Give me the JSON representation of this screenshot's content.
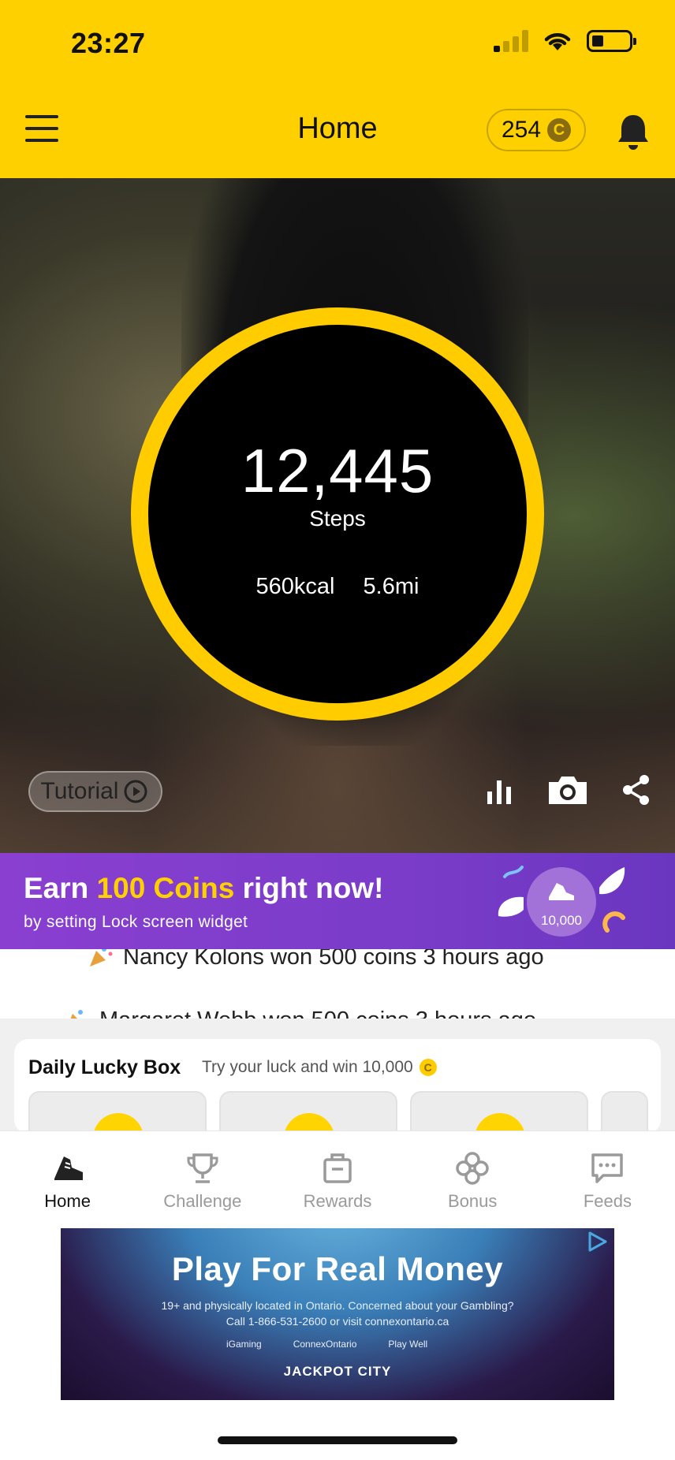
{
  "status_bar": {
    "time": "23:27"
  },
  "header": {
    "title": "Home",
    "coins": "254",
    "coin_symbol": "C"
  },
  "hero": {
    "steps": "12,445",
    "steps_label": "Steps",
    "kcal": "560kcal",
    "distance": "5.6mi",
    "tutorial_label": "Tutorial"
  },
  "promo": {
    "title_pre": "Earn ",
    "title_highlight": "100 Coins",
    "title_post": " right now!",
    "subtitle": "by setting Lock screen widget",
    "badge_value": "10,000"
  },
  "ticker": {
    "line1": "Nancy Kolons won 500 coins 3 hours ago",
    "line2": "Margaret Webb won 500 coins 3 hours ago"
  },
  "lucky_box": {
    "title": "Daily Lucky Box",
    "subtitle": "Try your luck and win 10,000",
    "coin_symbol": "C"
  },
  "tabs": [
    {
      "label": "Home",
      "icon": "sneaker-icon",
      "active": true
    },
    {
      "label": "Challenge",
      "icon": "trophy-icon",
      "active": false
    },
    {
      "label": "Rewards",
      "icon": "shopping-bag-icon",
      "active": false
    },
    {
      "label": "Bonus",
      "icon": "clover-icon",
      "active": false
    },
    {
      "label": "Feeds",
      "icon": "chat-icon",
      "active": false
    }
  ],
  "ad": {
    "title": "Play For Real Money",
    "line1": "19+ and physically located in Ontario. Concerned about your Gambling?",
    "line2": "Call 1-866-531-2600 or visit connexontario.ca",
    "logos": [
      "iGaming",
      "ConnexOntario",
      "Play Well"
    ],
    "brand": "JACKPOT CITY"
  },
  "colors": {
    "brand_yellow": "#FFD000",
    "ring_yellow": "#FFCC00",
    "promo_purple": "#7a3cc9"
  }
}
